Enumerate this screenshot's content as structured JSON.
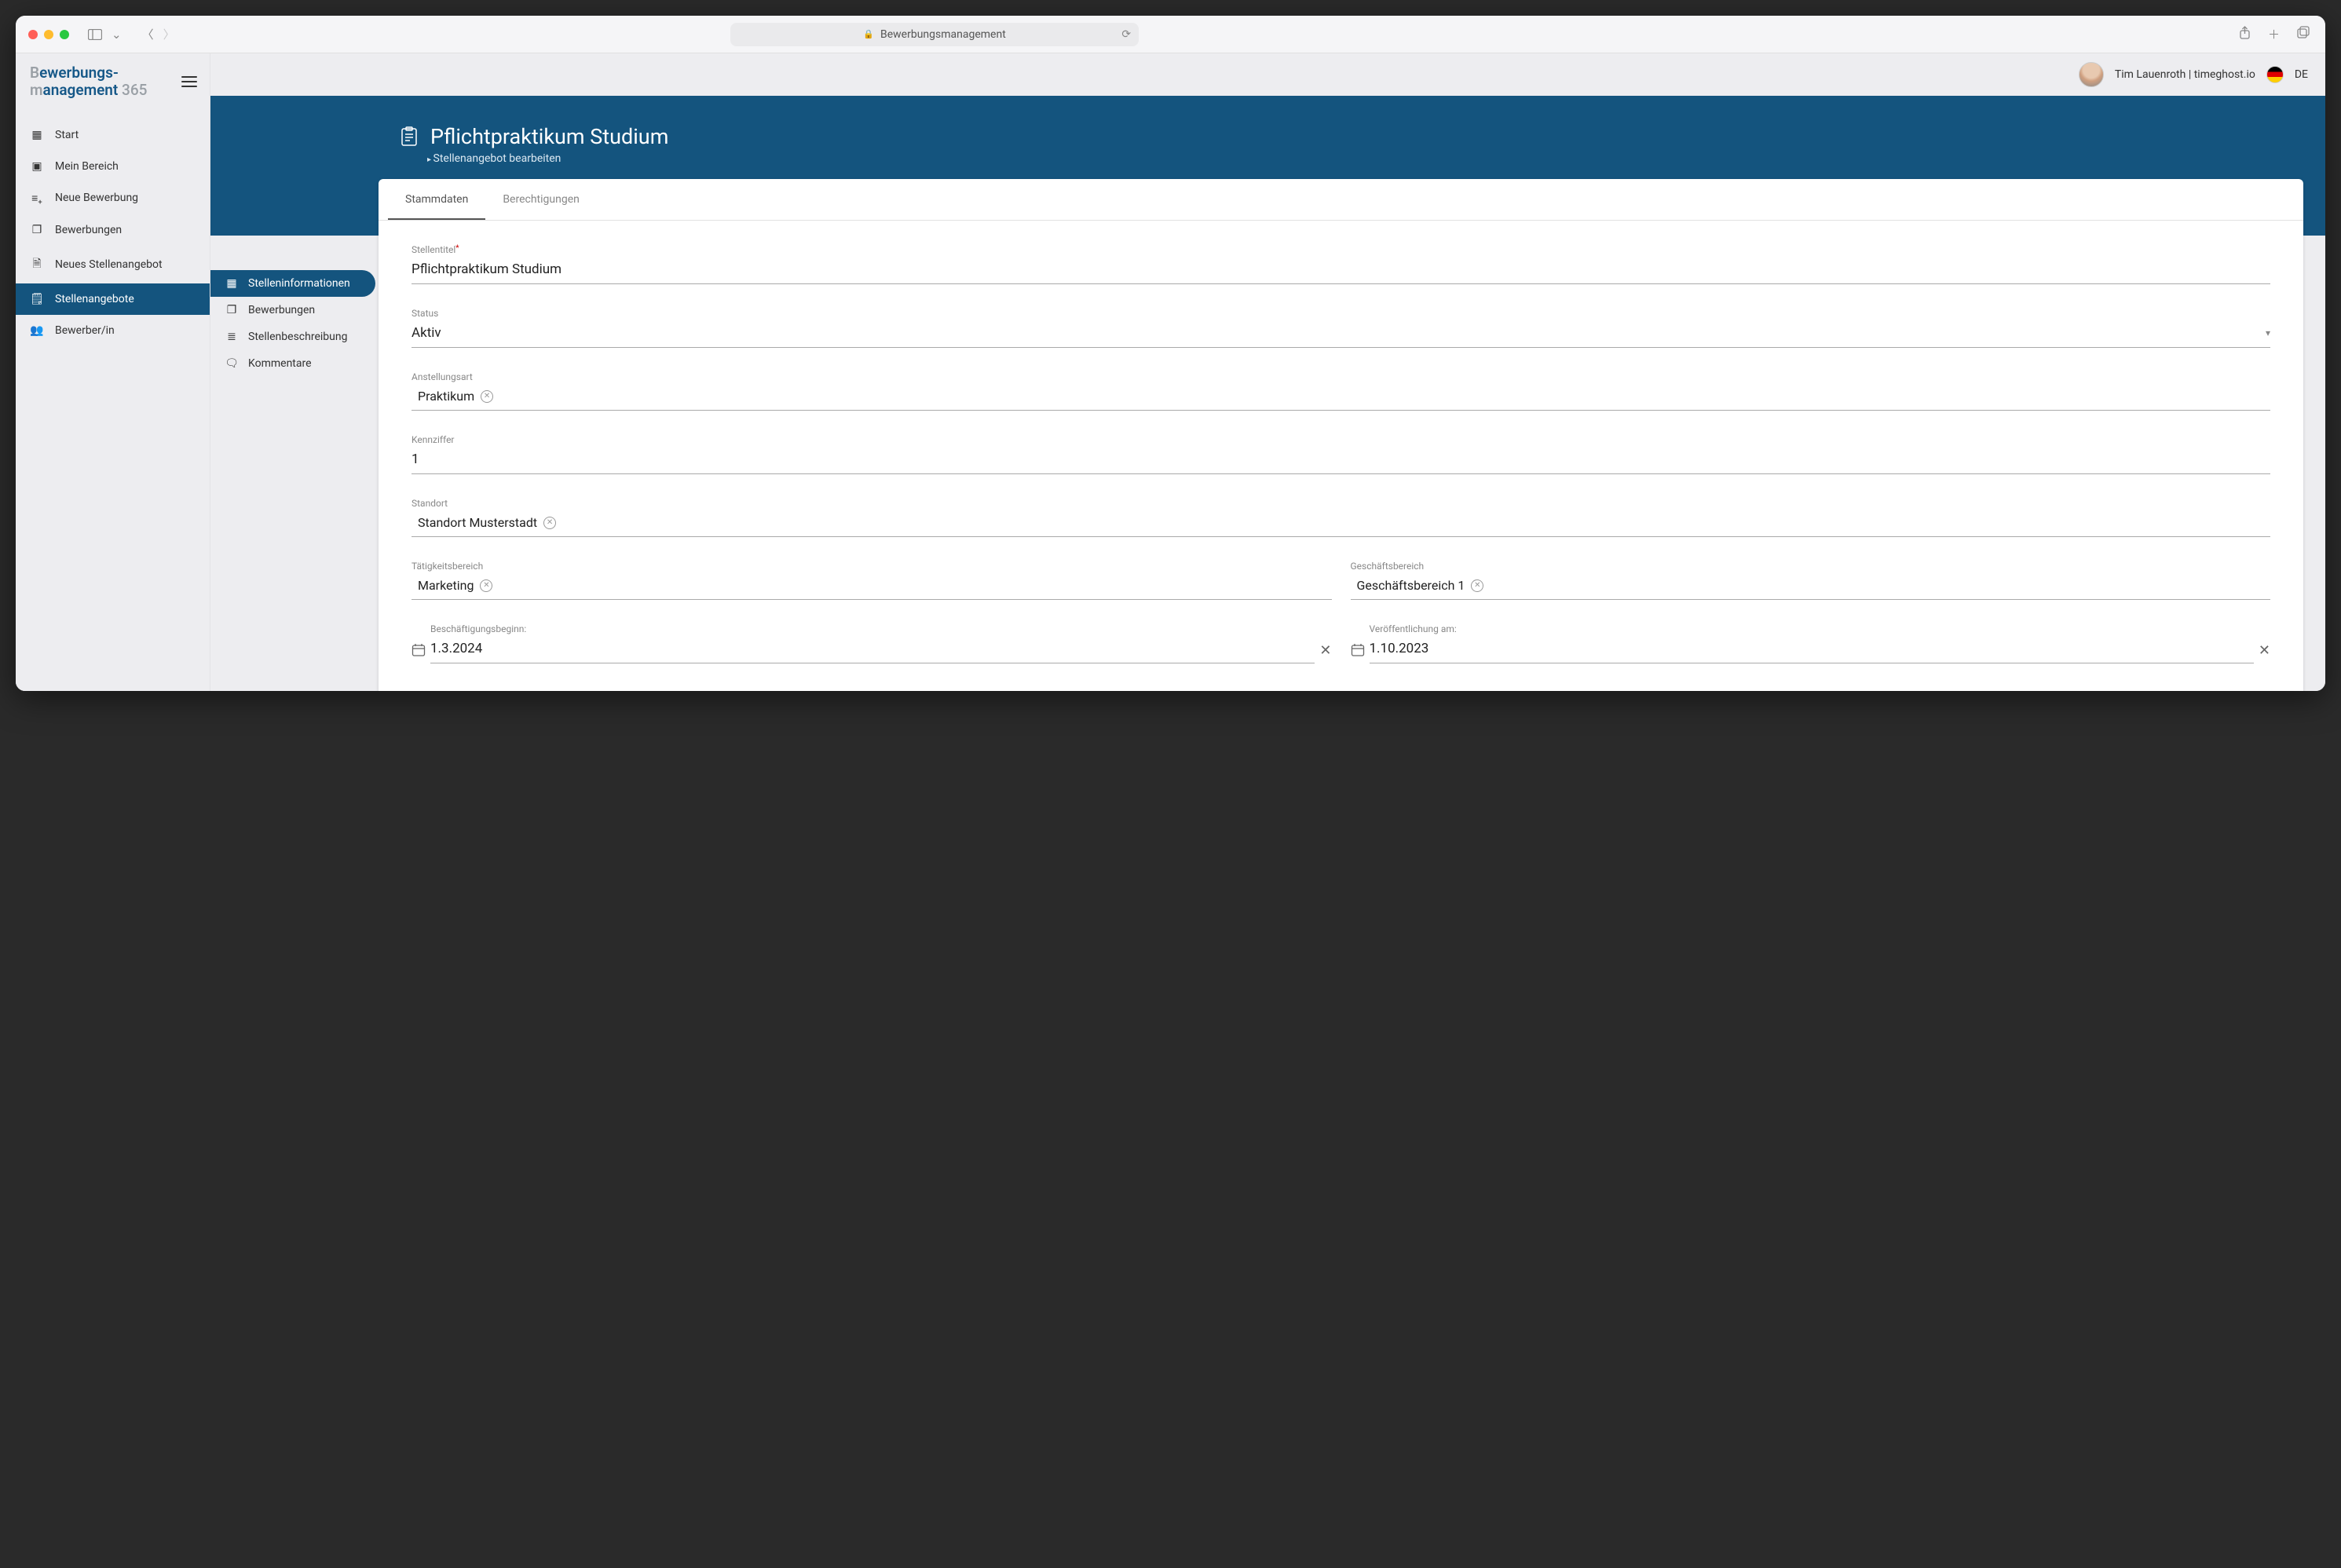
{
  "browser": {
    "address_label": "Bewerbungsmanagement"
  },
  "brand": {
    "line1_prefix": "B",
    "line1_rest": "ewerbungs-",
    "line2_prefix": "m",
    "line2_rest": "anagement",
    "suffix": " 365"
  },
  "user": {
    "display": "Tim Lauenroth | timeghost.io",
    "locale": "DE"
  },
  "sidebar": {
    "items": [
      {
        "label": "Start",
        "active": false
      },
      {
        "label": "Mein Bereich",
        "active": false
      },
      {
        "label": "Neue Bewerbung",
        "active": false
      },
      {
        "label": "Bewerbungen",
        "active": false
      },
      {
        "label": "Neues Stellenangebot",
        "active": false
      },
      {
        "label": "Stellenangebote",
        "active": true
      },
      {
        "label": "Bewerber/in",
        "active": false
      }
    ]
  },
  "subnav": {
    "items": [
      {
        "label": "Stelleninformationen",
        "active": true
      },
      {
        "label": "Bewerbungen",
        "active": false
      },
      {
        "label": "Stellenbeschreibung",
        "active": false
      },
      {
        "label": "Kommentare",
        "active": false
      }
    ]
  },
  "page": {
    "title": "Pflichtpraktikum Studium",
    "subtitle": "Stellenangebot bearbeiten"
  },
  "tabs": [
    {
      "label": "Stammdaten",
      "active": true
    },
    {
      "label": "Berechtigungen",
      "active": false
    }
  ],
  "form": {
    "stellentitel": {
      "label": "Stellentitel",
      "required": true,
      "value": "Pflichtpraktikum Studium"
    },
    "status": {
      "label": "Status",
      "value": "Aktiv"
    },
    "anstellungsart": {
      "label": "Anstellungsart",
      "chip": "Praktikum"
    },
    "kennziffer": {
      "label": "Kennziffer",
      "value": "1"
    },
    "standort": {
      "label": "Standort",
      "chip": "Standort Musterstadt"
    },
    "taetigkeitsbereich": {
      "label": "Tätigkeitsbereich",
      "chip": "Marketing"
    },
    "geschaeftsbereich": {
      "label": "Geschäftsbereich",
      "chip": "Geschäftsbereich 1"
    },
    "beginn": {
      "label": "Beschäftigungsbeginn:",
      "value": "1.3.2024"
    },
    "veroeffentlichung": {
      "label": "Veröffentlichung am:",
      "value": "1.10.2023"
    }
  },
  "colors": {
    "primary": "#14547e",
    "sidebar_bg": "#ededf0"
  }
}
